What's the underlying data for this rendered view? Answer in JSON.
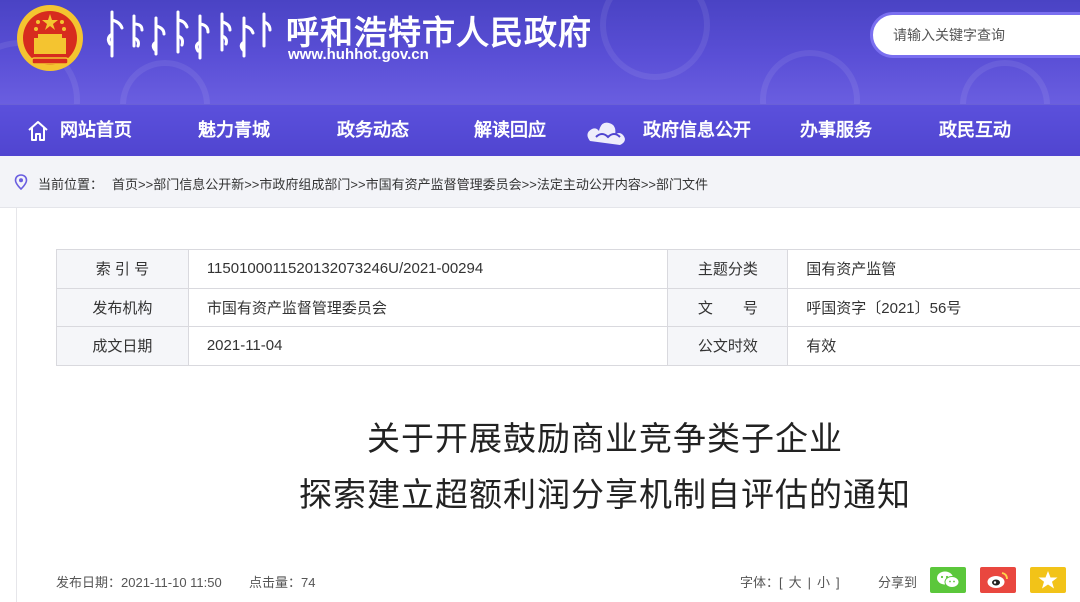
{
  "header": {
    "site_title": "呼和浩特市人民政府",
    "site_url": "www.huhhot.gov.cn",
    "emblem_icon": "national-emblem-icon",
    "mongolian_title_icon": "mongolian-script-title",
    "search": {
      "placeholder": "请输入关键字查询"
    }
  },
  "nav": {
    "items": [
      {
        "label": "网站首页",
        "icon": "home-icon"
      },
      {
        "label": "魅力青城"
      },
      {
        "label": "政务动态"
      },
      {
        "label": "解读回应"
      },
      {
        "label": "政府信息公开"
      },
      {
        "label": "办事服务"
      },
      {
        "label": "政民互动"
      }
    ]
  },
  "breadcrumb": {
    "label": "当前位置：",
    "items": [
      "首页",
      "部门信息公开新",
      "市政府组成部门",
      "市国有资产监督管理委员会",
      "法定主动公开内容",
      "部门文件"
    ],
    "separator": ">>"
  },
  "meta": {
    "rows": [
      {
        "label1": "索 引 号",
        "value1": "115010001152013207​3246U/2021-00294",
        "label2": "主题分类",
        "value2": "国有资产监管"
      },
      {
        "label1": "发布机构",
        "value1": "市国有资产监督管理委员会",
        "label2": "文　　号",
        "value2": "呼国资字〔2021〕56号"
      },
      {
        "label1": "成文日期",
        "value1": "2021-11-04",
        "label2": "公文时效",
        "value2": "有效"
      }
    ]
  },
  "document": {
    "title_line1": "关于开展鼓励商业竞争类子企业",
    "title_line2": "探索建立超额利润分享机制自评估的通知"
  },
  "footer": {
    "publish_date_label": "发布日期：",
    "publish_date": "2021-11-10 11:50",
    "hits_label": "点击量：",
    "hits": "74",
    "font_label": "字体：[",
    "font_large": "大",
    "font_divider": "|",
    "font_small": "小",
    "font_end": "]",
    "share_label": "分享到"
  },
  "colors": {
    "banner": "#5a4fd6",
    "nav": "#5045d0",
    "wechat": "#5bc73b",
    "weibo": "#e9473f",
    "qzone": "#f2c318"
  }
}
